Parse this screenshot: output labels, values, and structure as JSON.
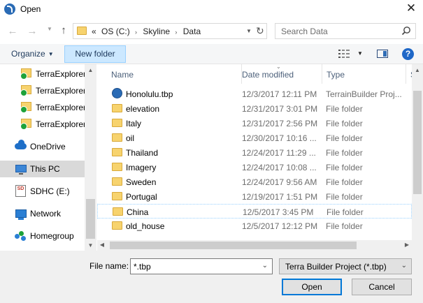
{
  "window": {
    "title": "Open",
    "close_glyph": "✕"
  },
  "address": {
    "back_glyph": "←",
    "forward_glyph": "→",
    "up_glyph": "↑",
    "refresh_glyph": "↻",
    "overflow": "«",
    "crumbs": [
      "OS (C:)",
      "Skyline",
      "Data"
    ],
    "separator": "›"
  },
  "search": {
    "placeholder": "Search Data"
  },
  "toolbar": {
    "organize_label": "Organize",
    "new_folder_label": "New folder",
    "help_label": "?"
  },
  "nav": {
    "items": [
      {
        "label": "TerraExplorer",
        "icon": "terraexplorer-folder-icon"
      },
      {
        "label": "TerraExplorer",
        "icon": "terraexplorer-folder-icon"
      },
      {
        "label": "TerraExplorer",
        "icon": "terraexplorer-folder-icon"
      },
      {
        "label": "TerraExplorer",
        "icon": "terraexplorer-folder-icon"
      },
      {
        "label": "OneDrive",
        "icon": "onedrive-icon"
      },
      {
        "label": "This PC",
        "icon": "this-pc-icon"
      },
      {
        "label": "SDHC (E:)",
        "icon": "sd-card-icon",
        "icon_text": "SD"
      },
      {
        "label": "Network",
        "icon": "network-icon"
      },
      {
        "label": "Homegroup",
        "icon": "homegroup-icon"
      }
    ]
  },
  "columns": {
    "name": "Name",
    "date": "Date modified",
    "type": "Type",
    "size": "S"
  },
  "files": [
    {
      "name": "Honolulu.tbp",
      "date": "12/3/2017 12:11 PM",
      "type": "TerrainBuilder Proj...",
      "kind": "tbp"
    },
    {
      "name": "elevation",
      "date": "12/31/2017 3:01 PM",
      "type": "File folder",
      "kind": "folder"
    },
    {
      "name": "Italy",
      "date": "12/31/2017 2:56 PM",
      "type": "File folder",
      "kind": "folder"
    },
    {
      "name": "oil",
      "date": "12/30/2017 10:16 ...",
      "type": "File folder",
      "kind": "folder"
    },
    {
      "name": "Thailand",
      "date": "12/24/2017 11:29 ...",
      "type": "File folder",
      "kind": "folder"
    },
    {
      "name": "Imagery",
      "date": "12/24/2017 10:08 ...",
      "type": "File folder",
      "kind": "folder"
    },
    {
      "name": "Sweden",
      "date": "12/24/2017 9:56 AM",
      "type": "File folder",
      "kind": "folder"
    },
    {
      "name": "Portugal",
      "date": "12/19/2017 1:51 PM",
      "type": "File folder",
      "kind": "folder"
    },
    {
      "name": "China",
      "date": "12/5/2017 3:45 PM",
      "type": "File folder",
      "kind": "folder"
    },
    {
      "name": "old_house",
      "date": "12/5/2017 12:12 PM",
      "type": "File folder",
      "kind": "folder"
    }
  ],
  "footer": {
    "file_name_label": "File name:",
    "file_name_value": "*.tbp",
    "file_type_value": "Terra Builder Project (*.tbp)",
    "open_label": "Open",
    "cancel_label": "Cancel"
  }
}
